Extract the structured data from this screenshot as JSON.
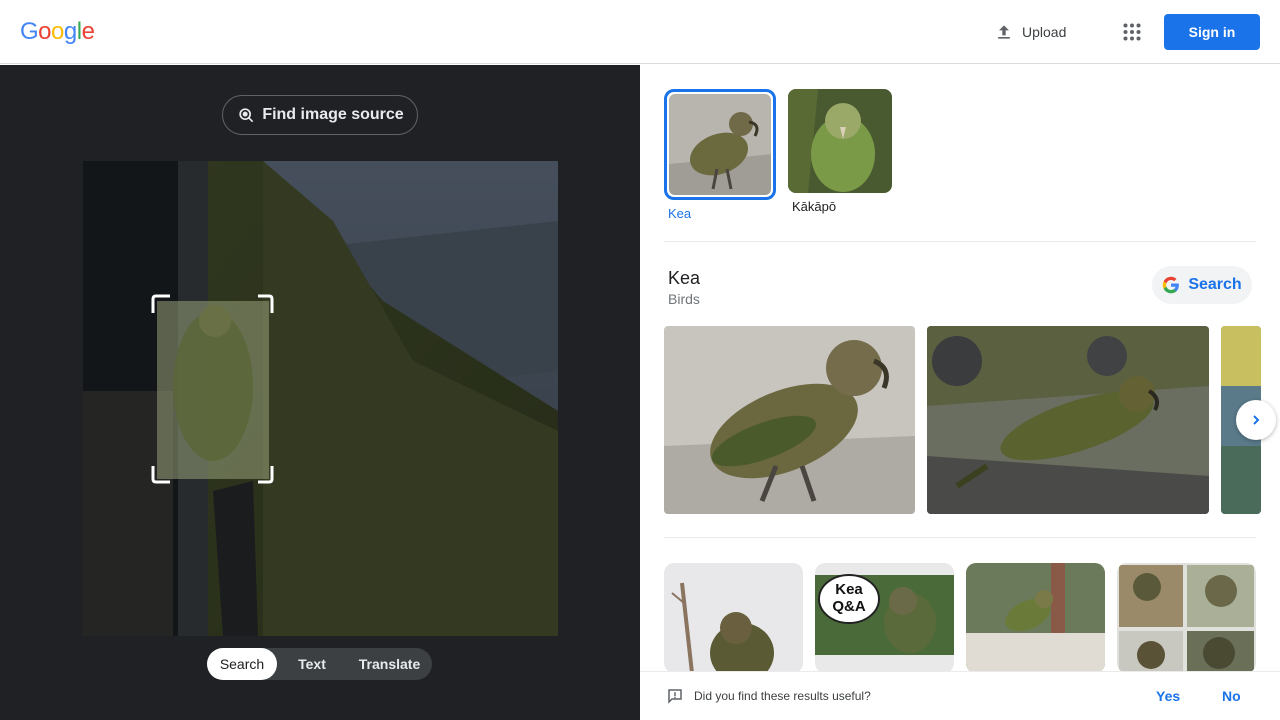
{
  "header": {
    "logo_letters": [
      "G",
      "o",
      "o",
      "g",
      "l",
      "e"
    ],
    "logo_colors": [
      "#4285f4",
      "#ea4335",
      "#fbbc05",
      "#4285f4",
      "#34a853",
      "#ea4335"
    ],
    "upload_label": "Upload",
    "apps_icon": "apps-grid-icon",
    "signin_label": "Sign in"
  },
  "left": {
    "find_source_label": "Find image source",
    "tabs": [
      {
        "label": "Search",
        "active": true
      },
      {
        "label": "Text",
        "active": false
      },
      {
        "label": "Translate",
        "active": false
      }
    ]
  },
  "right": {
    "chips": [
      {
        "label": "Kea",
        "selected": true
      },
      {
        "label": "Kākāpō",
        "selected": false
      }
    ],
    "entity": {
      "title": "Kea",
      "subtitle": "Birds",
      "search_label": "Search"
    },
    "grid_overlay": {
      "line1": "Kea",
      "line2": "Q&A"
    },
    "feedback": {
      "question": "Did you find these results useful?",
      "yes": "Yes",
      "no": "No"
    }
  },
  "colors": {
    "accent": "#1a73e8",
    "dark_panel": "#202124"
  }
}
